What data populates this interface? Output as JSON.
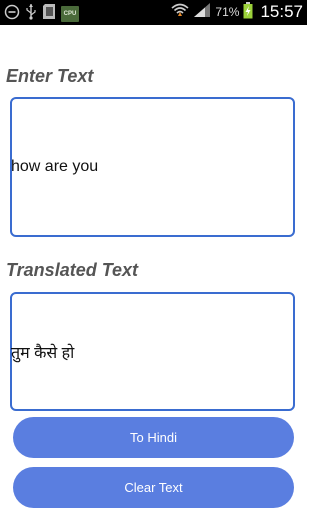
{
  "status_bar": {
    "cpu_label": "CPU",
    "battery_percent": "71%",
    "time": "15:57"
  },
  "input_section": {
    "label": "Enter Text",
    "value": "how are you"
  },
  "output_section": {
    "label": "Translated Text",
    "value": "तुम कैसे हो"
  },
  "buttons": {
    "translate_label": "To Hindi",
    "clear_label": "Clear Text"
  },
  "colors": {
    "accent": "#5a7ee0",
    "box_border": "#3a6cd0",
    "label_text": "#555555",
    "status_bar_bg": "#000000"
  }
}
